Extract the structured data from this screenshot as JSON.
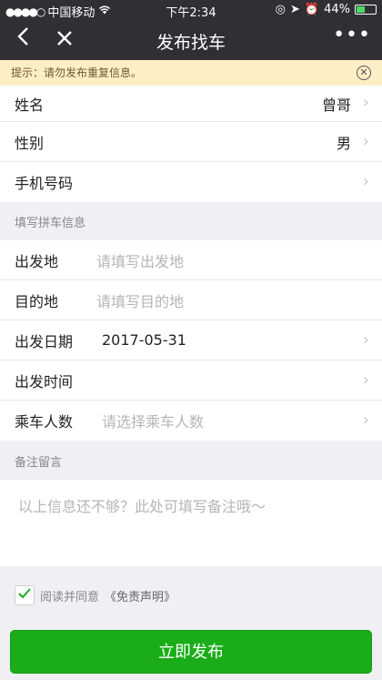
{
  "statusbar": {
    "carrier": "中国移动",
    "time": "下午2:34",
    "battery": "44%",
    "battery_level": 0.44
  },
  "navbar": {
    "title": "发布找车"
  },
  "notice": {
    "text": "提示：请勿发布重复信息。"
  },
  "profile": {
    "rows": [
      {
        "label": "姓名",
        "value": "曾哥"
      },
      {
        "label": "性别",
        "value": "男"
      },
      {
        "label": "手机号码",
        "value": ""
      }
    ]
  },
  "carpool": {
    "section_title": "填写拼车信息",
    "departure": {
      "label": "出发地",
      "placeholder": "请填写出发地"
    },
    "destination": {
      "label": "目的地",
      "placeholder": "请填写目的地"
    },
    "date": {
      "label": "出发日期",
      "value": "2017-05-31"
    },
    "time": {
      "label": "出发时间",
      "value": ""
    },
    "passengers": {
      "label": "乘车人数",
      "placeholder": "请选择乘车人数"
    }
  },
  "remark": {
    "section_title": "备注留言",
    "placeholder": "以上信息还不够？此处可填写备注哦～"
  },
  "agreement": {
    "text": "阅读并同意",
    "link": "《免责声明》",
    "checked": true
  },
  "publish": {
    "label": "立即发布"
  },
  "colors": {
    "primary": "#1aad19",
    "navbar": "#2f2f34",
    "notice_bg": "#fcefc6"
  }
}
